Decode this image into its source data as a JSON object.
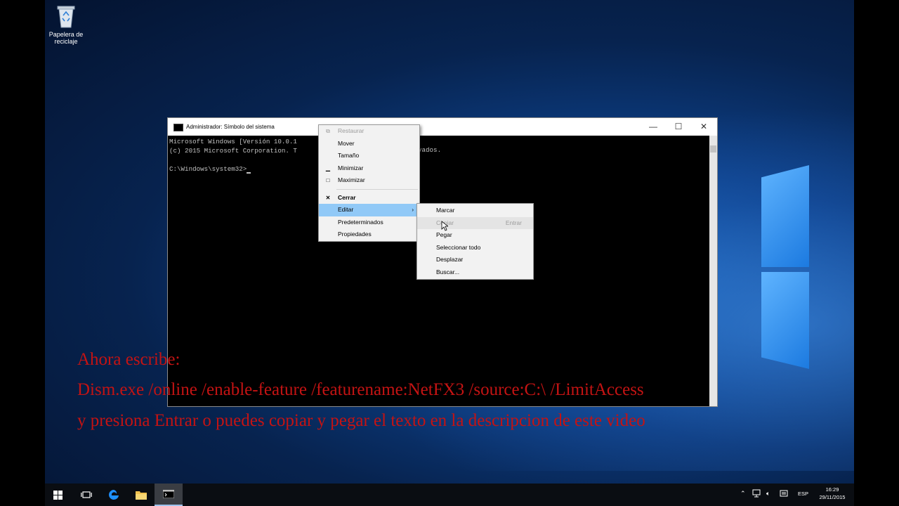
{
  "desktop": {
    "recycle_bin_label": "Papelera de reciclaje"
  },
  "cmd_window": {
    "title": "Administrador: Símbolo del sistema",
    "console_lines": [
      "Microsoft Windows [Versión 10.0.1",
      "(c) 2015 Microsoft Corporation. T",
      "",
      "C:\\Windows\\system32>"
    ],
    "console_line1_tail": "vados.",
    "controls": {
      "minimize": "—",
      "maximize": "☐",
      "close": "✕"
    }
  },
  "system_menu": {
    "items": [
      {
        "label": "Restaurar",
        "icon": "restore-icon",
        "disabled": true
      },
      {
        "label": "Mover"
      },
      {
        "label": "Tamaño"
      },
      {
        "label": "Minimizar",
        "icon": "minimize-icon"
      },
      {
        "label": "Maximizar",
        "icon": "maximize-icon"
      },
      {
        "label": "Cerrar",
        "icon": "close-icon"
      },
      {
        "label": "Editar",
        "highlighted": true,
        "submenu": true
      },
      {
        "label": "Predeterminados"
      },
      {
        "label": "Propiedades"
      }
    ]
  },
  "edit_submenu": {
    "items": [
      {
        "label": "Marcar"
      },
      {
        "label": "Copiar",
        "shortcut": "Entrar",
        "disabled": true
      },
      {
        "label": "Pegar"
      },
      {
        "label": "Seleccionar todo"
      },
      {
        "label": "Desplazar"
      },
      {
        "label": "Buscar..."
      }
    ]
  },
  "overlay_text": {
    "line1": "Ahora escribe:",
    "line2": "Dism.exe /online /enable-feature /featurename:NetFX3 /source:C:\\ /LimitAccess",
    "line3": "y presiona Entrar o puedes copiar y pegar el texto en la descripcion de este video",
    "color": "#c41313"
  },
  "taskbar": {
    "language": "ESP",
    "time": "16:29",
    "date": "29/11/2015",
    "items": [
      "start-icon",
      "task-view-icon",
      "edge-icon",
      "file-explorer-icon",
      "cmd-icon"
    ]
  }
}
